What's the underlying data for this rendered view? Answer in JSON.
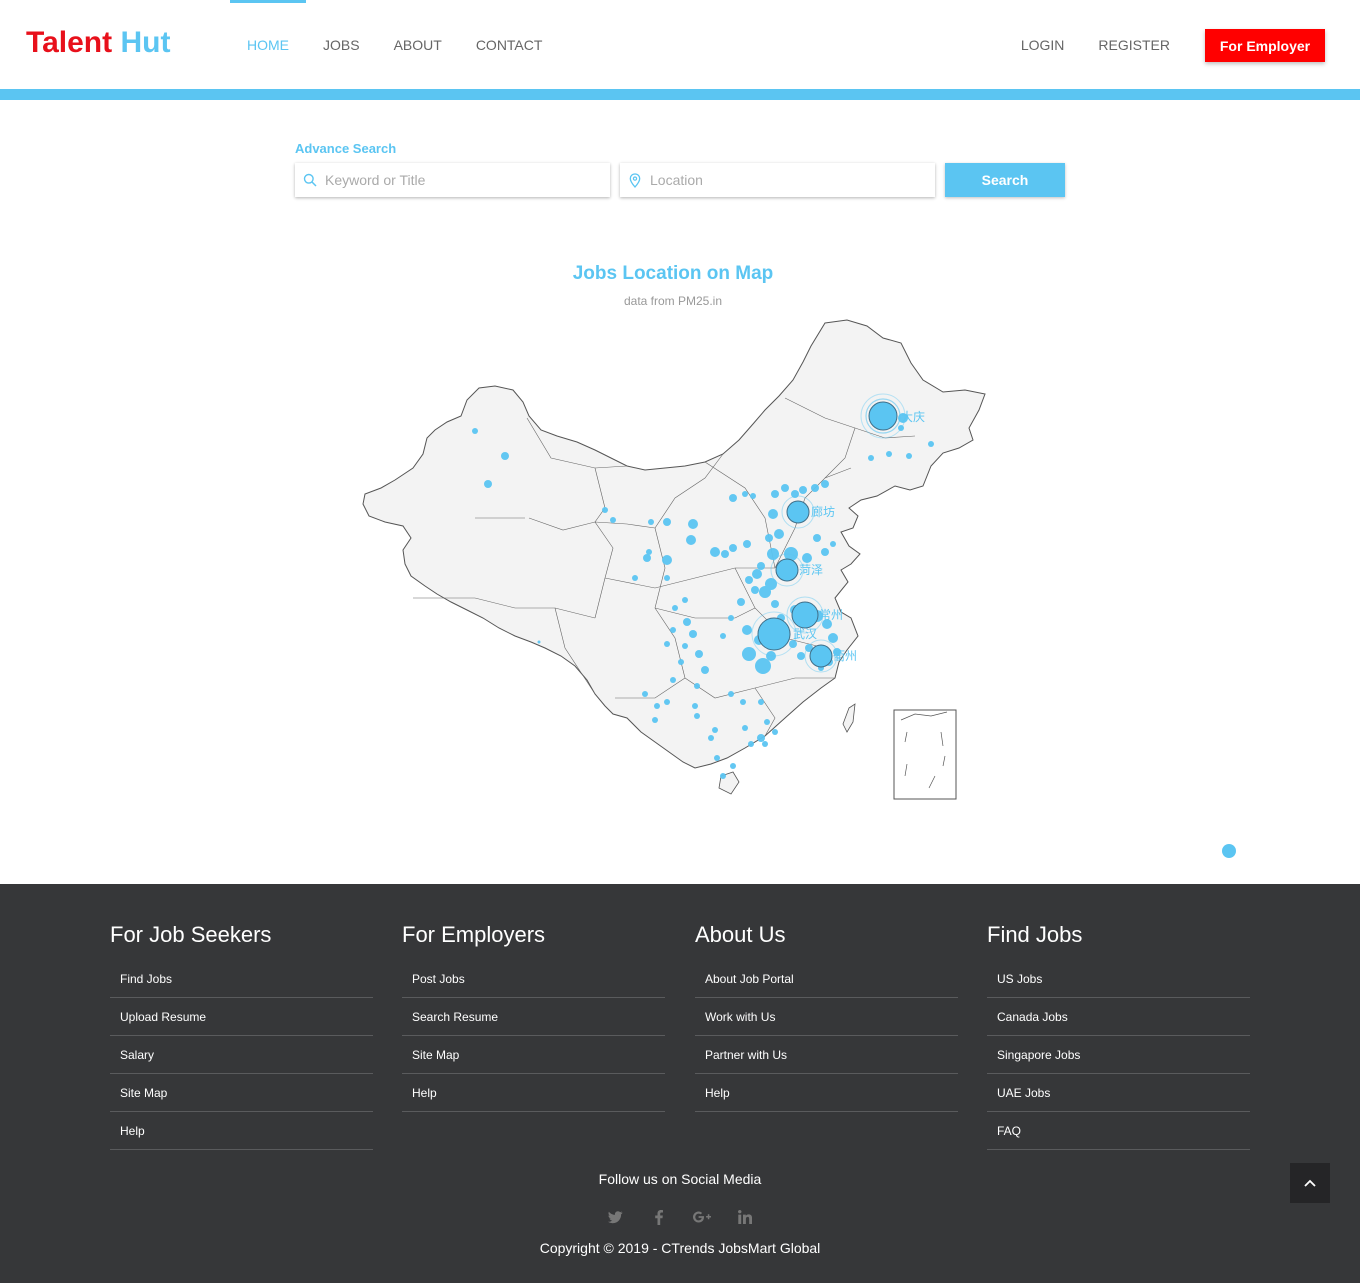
{
  "brand": {
    "part1": "Talent",
    "part2": "Hut",
    "color1": "#e8101b",
    "color2": "#5bc5f2"
  },
  "nav": {
    "left": [
      {
        "label": "HOME",
        "active": true
      },
      {
        "label": "JOBS"
      },
      {
        "label": "ABOUT"
      },
      {
        "label": "CONTACT"
      }
    ],
    "right": [
      {
        "label": "LOGIN"
      },
      {
        "label": "REGISTER"
      }
    ],
    "employer_button": "For Employer"
  },
  "search": {
    "label": "Advance Search",
    "keyword_placeholder": "Keyword or Title",
    "location_placeholder": "Location",
    "button": "Search"
  },
  "map": {
    "title": "Jobs Location on Map",
    "subtitle": "data from PM25.in",
    "accent": "#5bc5f2",
    "labels": [
      "大庆",
      "廊坊",
      "菏泽",
      "常州",
      "武汉",
      "衢州"
    ]
  },
  "footer": {
    "columns": [
      {
        "title": "For Job Seekers",
        "items": [
          "Find Jobs",
          "Upload Resume",
          "Salary",
          "Site Map",
          "Help"
        ]
      },
      {
        "title": "For Employers",
        "items": [
          "Post Jobs",
          "Search Resume",
          "Site Map",
          "Help"
        ]
      },
      {
        "title": "About Us",
        "items": [
          "About Job Portal",
          "Work with Us",
          "Partner with Us",
          "Help"
        ]
      },
      {
        "title": "Find Jobs",
        "items": [
          "US Jobs",
          "Canada Jobs",
          "Singapore Jobs",
          "UAE Jobs",
          "FAQ"
        ]
      }
    ],
    "follow": "Follow us on Social Media",
    "social": [
      "twitter-icon",
      "facebook-icon",
      "google-plus-icon",
      "linkedin-icon"
    ],
    "copyright": "Copyright © 2019 - CTrends JobsMart Global"
  }
}
